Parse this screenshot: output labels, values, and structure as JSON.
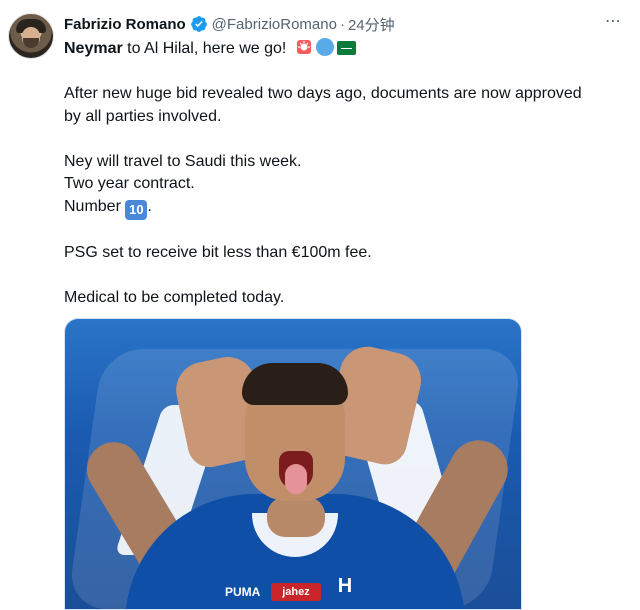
{
  "tweet": {
    "author_name": "Fabrizio Romano",
    "handle": "@FabrizioRomano",
    "separator": "·",
    "time": "24分钟",
    "menu_icon": "more-icon",
    "verified_icon": "verified-badge-icon",
    "lines": [
      {
        "prefix": "Neymar",
        "text": " to Al Hilal, here we go! "
      },
      {
        "text": ""
      },
      {
        "text": "After new huge bid revealed two days ago, documents are now approved"
      },
      {
        "text": "by all parties involved."
      },
      {
        "text": ""
      },
      {
        "text": "Ney will travel to Saudi this week."
      },
      {
        "text": "Two year contract."
      },
      {
        "text": "Number "
      },
      {
        "text": ""
      },
      {
        "text": "PSG set to receive bit less than €100m fee."
      },
      {
        "text": ""
      },
      {
        "text": "Medical to be completed today."
      }
    ],
    "emoji_siren": "siren-emoji",
    "emoji_blue_circle": "blue-circle-emoji",
    "emoji_flag": "saudi-flag-emoji",
    "emoji_keycap": "keycap-ten-emoji",
    "keycap_text": "10",
    "flag_text": "سعودية",
    "image": {
      "sponsor_text": "jahez",
      "logo_text": "H",
      "brand_text": "PUMA"
    }
  }
}
